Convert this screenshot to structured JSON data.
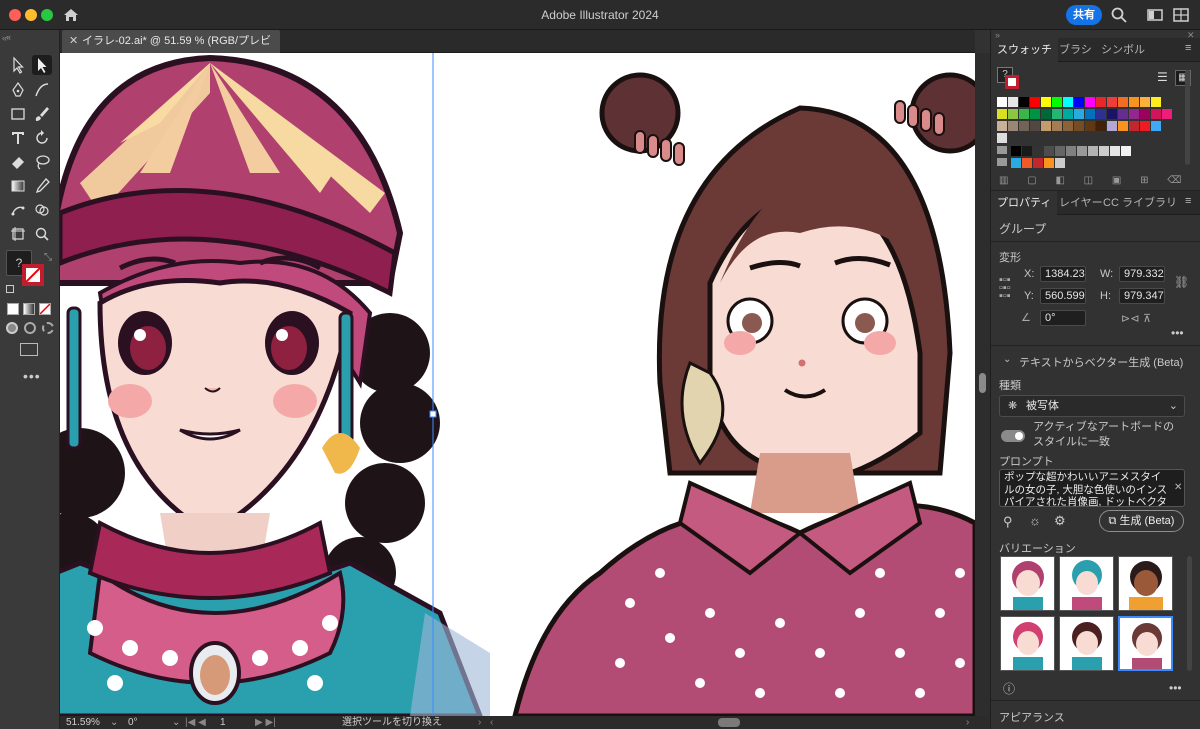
{
  "app": {
    "title": "Adobe Illustrator 2024",
    "share_label": "共有"
  },
  "document": {
    "tab_label": "イラレ-02.ai* @ 51.59 % (RGB/プレビュー)"
  },
  "status": {
    "zoom": "51.59%",
    "rotation": "0°",
    "artboard": "1",
    "tool_hint": "選択ツールを切り換え"
  },
  "swatch_panel": {
    "tabs": [
      "スウォッチ",
      "ブラシ",
      "シンボル"
    ],
    "colors_row1": [
      "#ffffff",
      "#e6e6e6",
      "#000000",
      "#ff0000",
      "#ffff00",
      "#00ff00",
      "#00ffff",
      "#0000ff",
      "#ff00ff",
      "#e8262b",
      "#ee3d3d",
      "#f26d21",
      "#f7941d",
      "#fbb03b",
      "#fcee21"
    ],
    "colors_row2": [
      "#d9e021",
      "#8cc63f",
      "#39b54a",
      "#009245",
      "#006837",
      "#22b573",
      "#00a99d",
      "#29abe2",
      "#0071bc",
      "#2e3192",
      "#1b1464",
      "#662d91",
      "#93278f",
      "#9e005d",
      "#d4145a",
      "#ed1e79"
    ],
    "colors_row3": [
      "#c7b299",
      "#998675",
      "#736357",
      "#534741",
      "#c69c6d",
      "#a67c52",
      "#8c6239",
      "#754c24",
      "#603813",
      "#42210b",
      "#b4a7d6",
      "#f7931e",
      "#c1272d",
      "#ed1c24",
      "#3fa9f5"
    ],
    "grays": [
      "#000000",
      "#1a1a1a",
      "#333333",
      "#4d4d4d",
      "#666666",
      "#808080",
      "#999999",
      "#b3b3b3",
      "#cccccc",
      "#e6e6e6",
      "#f2f2f2"
    ],
    "group_colors": [
      "#29abe2",
      "#f15a24",
      "#c1272d",
      "#f7931e",
      "#cccccc"
    ]
  },
  "properties_panel": {
    "tabs": [
      "プロパティ",
      "レイヤー",
      "CC ライブラリ"
    ],
    "selection_type": "グループ",
    "transform_label": "変形",
    "x_label": "X:",
    "x_value": "1384.23",
    "y_label": "Y:",
    "y_value": "560.599",
    "w_label": "W:",
    "w_value": "979.332",
    "h_label": "H:",
    "h_value": "979.347",
    "angle_value": "0°",
    "text_to_vector_label": "テキストからベクター生成 (Beta)",
    "kind_label": "種類",
    "kind_value": "被写体",
    "match_artboard_label": "アクティブなアートボードのスタイルに一致",
    "prompt_label": "プロンプト",
    "prompt_text": "ポップな超かわいいアニメスタイルの女の子, 大胆な色使いのインスパイアされた肖像画, ドットベクター, 着",
    "generate_label": "生成 (Beta)",
    "variations_label": "バリエーション",
    "appearance_label": "アピアランス"
  },
  "colors": {
    "accent": "#1473e6",
    "selection": "#3d8bff",
    "skin": "#f8dcd4",
    "magenta": "#b0406e",
    "hair_brown": "#6b3a37",
    "teal": "#2a9fae"
  }
}
